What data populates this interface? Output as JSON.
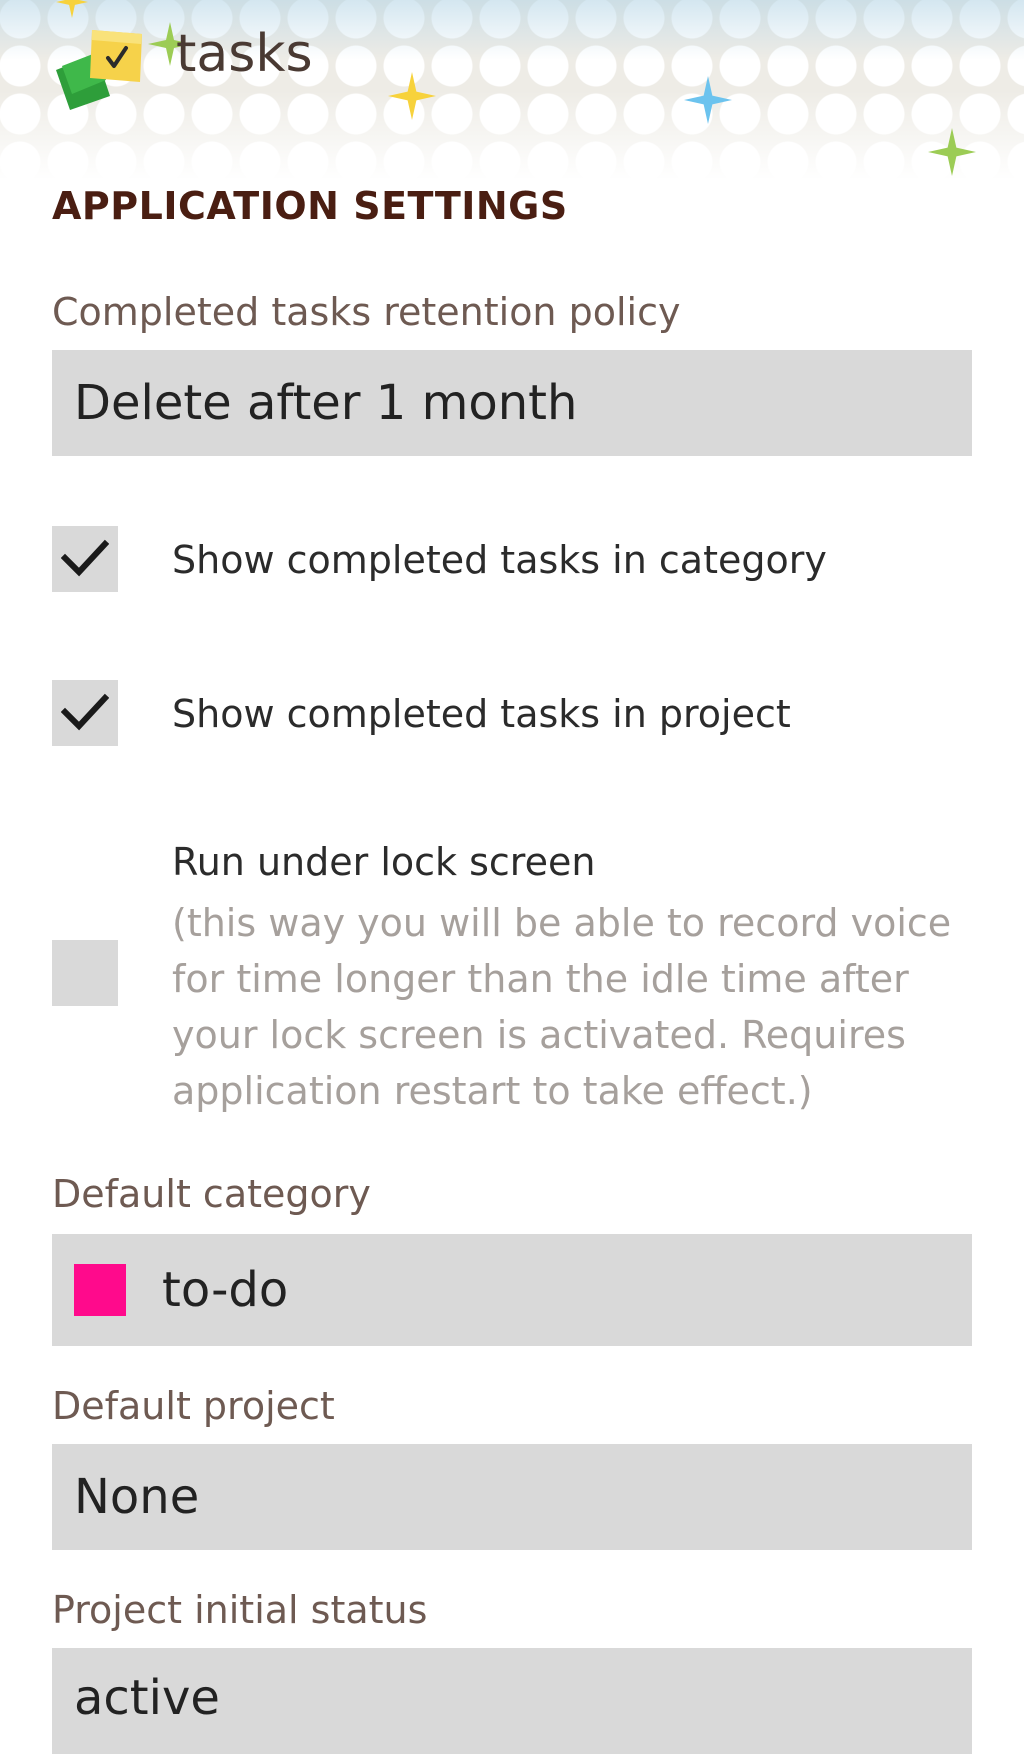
{
  "app": {
    "title": "tasks"
  },
  "settings": {
    "section_title": "APPLICATION SETTINGS",
    "retention": {
      "label": "Completed tasks retention policy",
      "value": "Delete after 1 month"
    },
    "show_in_category": {
      "label": "Show completed tasks in category",
      "checked": true
    },
    "show_in_project": {
      "label": "Show completed tasks in project",
      "checked": true
    },
    "lock_screen": {
      "label": "Run under lock screen",
      "description": "(this way you will be able to record voice for time longer than the idle time after your lock screen is activated. Requires application restart to take effect.)",
      "checked": false
    },
    "default_category": {
      "label": "Default category",
      "value": "to-do",
      "color": "#ff0a8c"
    },
    "default_project": {
      "label": "Default project",
      "value": "None"
    },
    "project_initial_status": {
      "label": "Project initial status",
      "value": "active"
    }
  },
  "icons": {
    "logo": "tasks-logo-icon",
    "check": "checkmark-icon"
  },
  "colors": {
    "section_title": "#4a1e12",
    "label": "#6e5a52",
    "control_bg": "#d9d9d9",
    "description": "#a6a09c"
  }
}
